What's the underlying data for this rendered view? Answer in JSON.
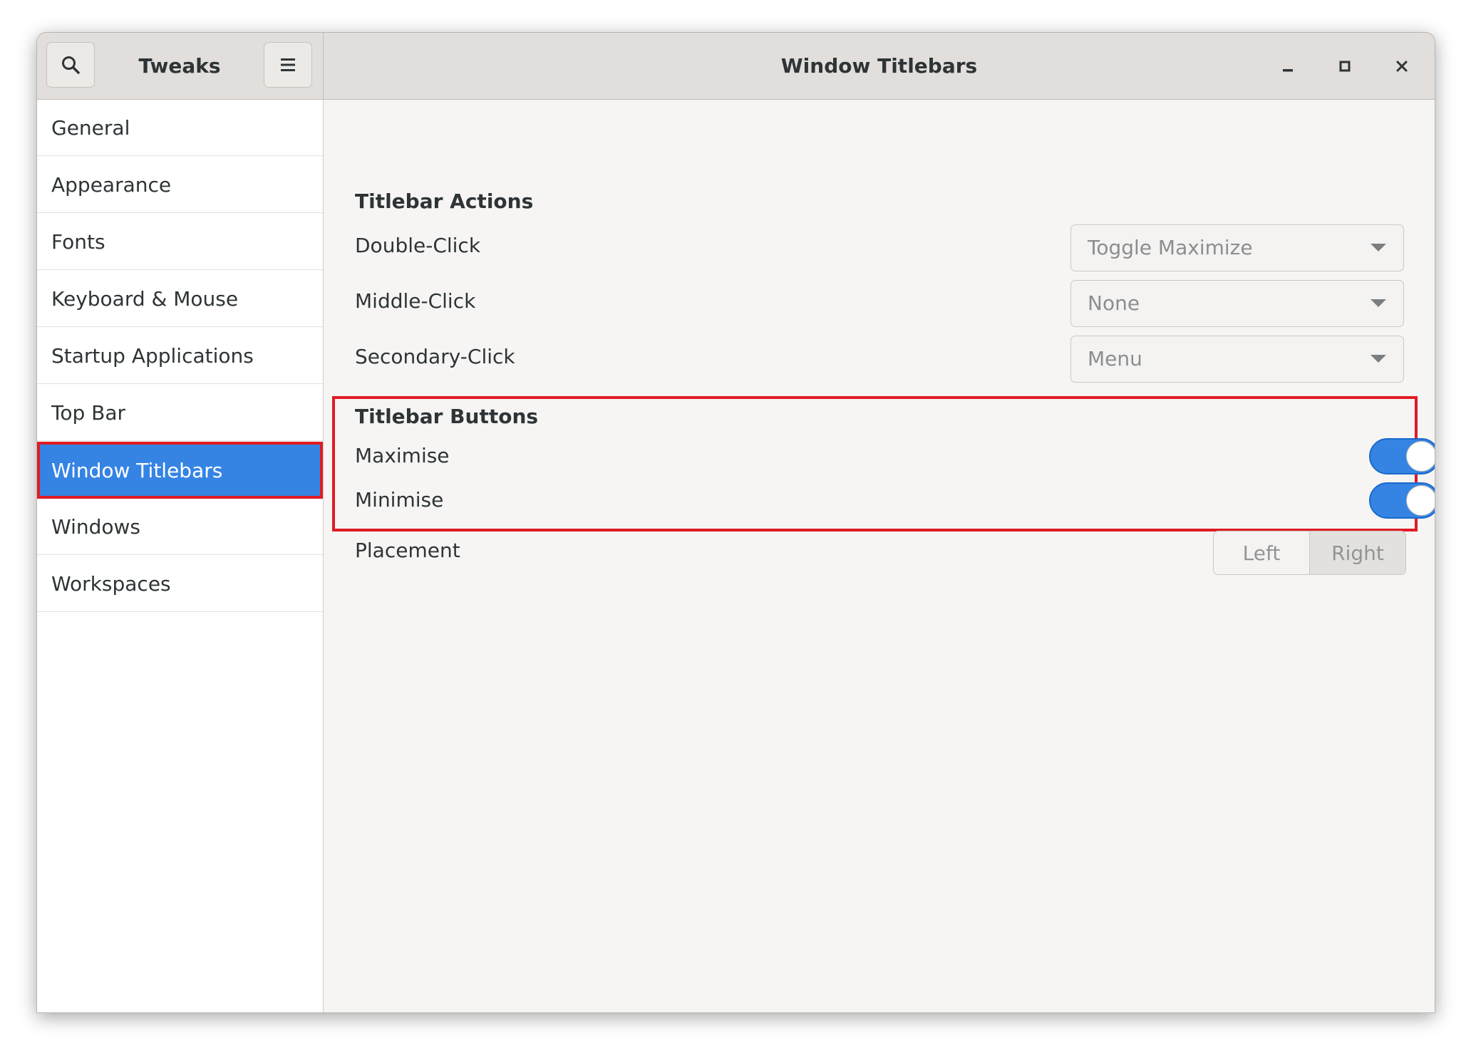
{
  "app": {
    "sidebar_title": "Tweaks",
    "page_title": "Window Titlebars"
  },
  "icons": {
    "search": "search-icon",
    "menu": "hamburger-menu-icon",
    "minimize": "minimize-icon",
    "maximize": "maximize-icon",
    "close": "close-icon"
  },
  "sidebar": {
    "items": [
      {
        "label": "General"
      },
      {
        "label": "Appearance"
      },
      {
        "label": "Fonts"
      },
      {
        "label": "Keyboard & Mouse"
      },
      {
        "label": "Startup Applications"
      },
      {
        "label": "Top Bar"
      },
      {
        "label": "Window Titlebars",
        "selected": true
      },
      {
        "label": "Windows"
      },
      {
        "label": "Workspaces"
      }
    ]
  },
  "titlebar_actions": {
    "heading": "Titlebar Actions",
    "double_click": {
      "label": "Double-Click",
      "value": "Toggle Maximize"
    },
    "middle_click": {
      "label": "Middle-Click",
      "value": "None"
    },
    "secondary_click": {
      "label": "Secondary-Click",
      "value": "Menu"
    }
  },
  "titlebar_buttons": {
    "heading": "Titlebar Buttons",
    "maximise": {
      "label": "Maximise",
      "enabled": true
    },
    "minimise": {
      "label": "Minimise",
      "enabled": true
    },
    "placement": {
      "label": "Placement",
      "left": "Left",
      "right": "Right",
      "selected": "Right"
    }
  },
  "colors": {
    "accent": "#3584e4",
    "highlight": "#e01b24",
    "headerbar": "#e1dedb",
    "content_bg": "#f6f5f4"
  }
}
